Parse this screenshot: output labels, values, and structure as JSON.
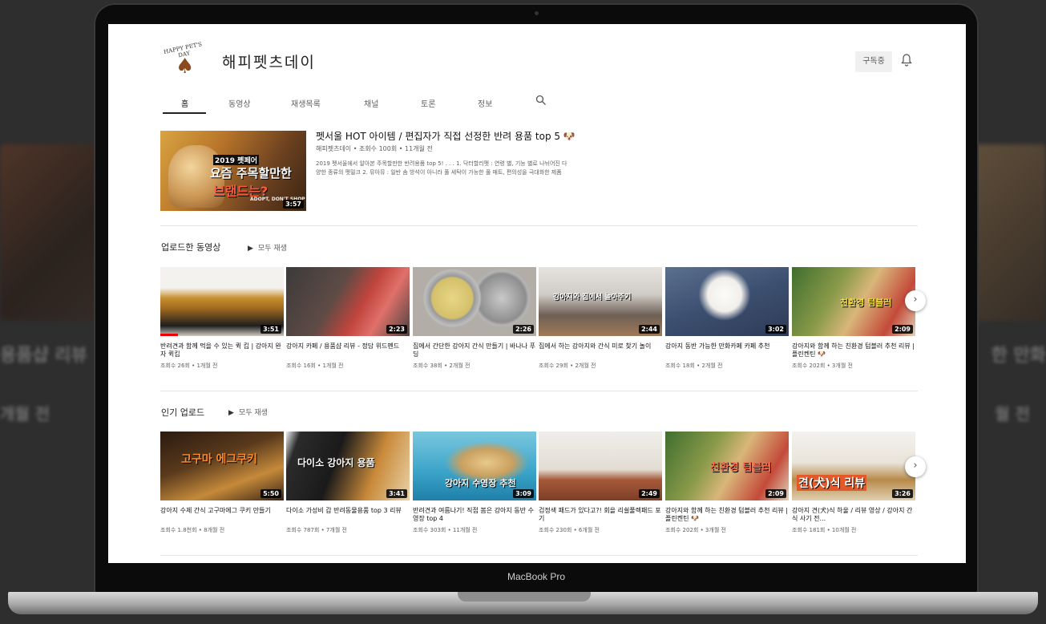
{
  "background": {
    "left_text_1": "용품샵 리뷰",
    "left_text_2": "개월 전",
    "right_text_1": "한 만화",
    "right_text_2": "월 전"
  },
  "device": {
    "label": "MacBook Pro"
  },
  "channel": {
    "logo_text": "HAPPY PET'S DAY",
    "name": "해피펫츠데이",
    "subscribe_label": "구독중"
  },
  "tabs": [
    {
      "label": "홈",
      "active": true
    },
    {
      "label": "동영상",
      "active": false
    },
    {
      "label": "재생목록",
      "active": false
    },
    {
      "label": "채널",
      "active": false
    },
    {
      "label": "토론",
      "active": false
    },
    {
      "label": "정보",
      "active": false
    }
  ],
  "featured": {
    "thumb_lines": [
      "2019 펫페어",
      "요즘 주목할만한",
      "브랜드는?",
      "ADOPT, DON'T SHOP"
    ],
    "duration": "3:57",
    "title": "펫서울 HOT 아이템 / 편집자가 직접 선정한 반려 용품 top 5 🐶",
    "meta": "해피펫츠데이 • 조회수 100회 • 11개월 전",
    "desc_line1": "2019 펫서울에서 알아본 주목할만한 반려용품 top 5! . . . 1. 닥터할리펫 : 연령 별, 기능 별로 나뉘어진 다",
    "desc_line2": "양한 종류의 펫밀크 2. 뮤아뮤 : 일반 솜 방석이 아니라 풀 세탁이 가능한 풀 매트, 편의성을 극대화한 제품"
  },
  "uploads": {
    "title": "업로드한 동영상",
    "play_all": "모두 재생",
    "videos": [
      {
        "title": "반려견과 함께 먹을 수 있는 퀵 킵 | 강아지 완자 퀵킵",
        "meta": "조회수 26회 • 1개월 전",
        "duration": "3:51",
        "overlay": ""
      },
      {
        "title": "강아지 카페 / 용품샵 리뷰 - 정담 위드펜드",
        "meta": "조회수 16회 • 1개월 전",
        "duration": "2:23",
        "overlay": ""
      },
      {
        "title": "집에서 간단한 강아지 간식 만들기 | 바나나 푸딩",
        "meta": "조회수 38회 • 2개월 전",
        "duration": "2:26",
        "overlay": ""
      },
      {
        "title": "집에서 하는 강아지와 간식 미로 찾기 놀이",
        "meta": "조회수 29회 • 2개월 전",
        "duration": "2:44",
        "overlay": "강아지와 집에서 놀아주기"
      },
      {
        "title": "강아지 동반 가능한 만화카페 카페 추천",
        "meta": "조회수 18회 • 2개월 전",
        "duration": "3:02",
        "overlay": ""
      },
      {
        "title": "강아지와 함께 하는 친환경 텀블러 추천 리뷰 | 플린켄틴 🐶",
        "meta": "조회수 202회 • 3개월 전",
        "duration": "2:09",
        "overlay": "친환경 텀블러"
      }
    ]
  },
  "popular": {
    "title": "인기 업로드",
    "play_all": "모두 재생",
    "videos": [
      {
        "title": "강아지 수제 간식 고구마에그 쿠키 만들기",
        "meta": "조회수 1.8천회 • 8개월 전",
        "duration": "5:50",
        "overlay": "고구마 에그쿠키"
      },
      {
        "title": "다이소 가성비 갑 반려동물용품 top 3 리뷰",
        "meta": "조회수 787회 • 7개월 전",
        "duration": "3:41",
        "overlay": "다이소 강아지 용품"
      },
      {
        "title": "반려견과 여름나기! 직접 봄은 강아지 동반 수영장 top 4",
        "meta": "조회수 303회 • 11개월 전",
        "duration": "3:09",
        "overlay": "강아지 수영장 추천"
      },
      {
        "title": "검정색 패드가 있다고?! 회을 리쉴풀렉패드 포기",
        "meta": "조회수 230회 • 6개월 전",
        "duration": "2:49",
        "overlay": ""
      },
      {
        "title": "강아지와 함께 하는 친환경 텀블러 추천 리뷰 | 플린켄틴 🐶",
        "meta": "조회수 202회 • 3개월 전",
        "duration": "2:09",
        "overlay": "친환경 텀블러"
      },
      {
        "title": "강아지 견(犬)식 하울 / 리뷰 영상 / 강아지 간식 사기 전...",
        "meta": "조회수 181회 • 10개월 전",
        "duration": "3:26",
        "overlay": "견(犬)식 리뷰"
      }
    ]
  },
  "colors": {
    "progress": "#e00000",
    "screen_bg": "#ffffff"
  }
}
